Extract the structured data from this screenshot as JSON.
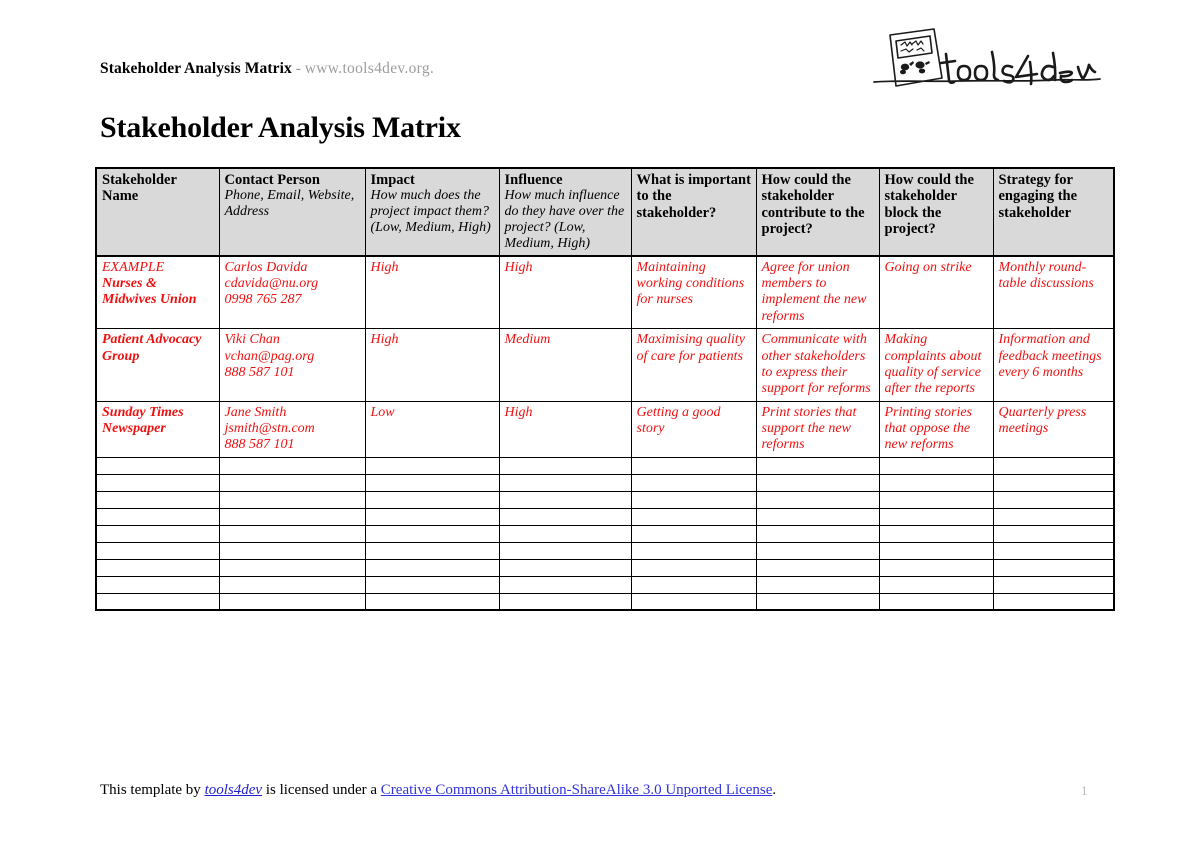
{
  "header": {
    "running_title": "Stakeholder Analysis Matrix",
    "separator": "-",
    "running_url": "www.tools4dev.org.",
    "logo_text": "tools4dev"
  },
  "document": {
    "title": "Stakeholder Analysis Matrix"
  },
  "table": {
    "columns": [
      {
        "main": "Stakeholder Name",
        "sub": ""
      },
      {
        "main": "Contact Person",
        "sub": "Phone, Email, Website, Address"
      },
      {
        "main": "Impact",
        "sub": "How much does the project impact them? (Low, Medium, High)"
      },
      {
        "main": "Influence",
        "sub": "How much influence do they have over the project? (Low, Medium, High)"
      },
      {
        "main": "What is important to the stakeholder?",
        "sub": ""
      },
      {
        "main": "How could the stakeholder contribute to the project?",
        "sub": ""
      },
      {
        "main": "How could the stakeholder block the project?",
        "sub": ""
      },
      {
        "main": "Strategy for engaging the stakeholder",
        "sub": ""
      }
    ],
    "rows": [
      {
        "name_prefix": "EXAMPLE",
        "name": "Nurses & Midwives Union",
        "contact_name": "Carlos Davida",
        "contact_email": "cdavida@nu.org",
        "contact_phone": "0998 765 287",
        "impact": "High",
        "influence": "High",
        "important": "Maintaining working conditions for nurses",
        "contribute": "Agree for union members to implement the new reforms",
        "block": "Going on strike",
        "strategy": "Monthly round-table discussions"
      },
      {
        "name_prefix": "",
        "name": "Patient Advocacy Group",
        "contact_name": "Viki Chan",
        "contact_email": "vchan@pag.org",
        "contact_phone": "888 587 101",
        "impact": "High",
        "influence": "Medium",
        "important": "Maximising quality of care for patients",
        "contribute": "Communicate with other stakeholders to express their support for reforms",
        "block": "Making complaints about quality of service after the reports",
        "strategy": "Information and feedback meetings every 6 months"
      },
      {
        "name_prefix": "",
        "name": "Sunday Times Newspaper",
        "contact_name": "Jane Smith",
        "contact_email": "jsmith@stn.com",
        "contact_phone": "888 587 101",
        "impact": "Low",
        "influence": "High",
        "important": "Getting a good story",
        "contribute": "Print stories that support the new reforms",
        "block": "Printing stories that oppose the new reforms",
        "strategy": "Quarterly press meetings"
      }
    ],
    "blank_row_count": 9
  },
  "footer": {
    "text_before": "This template by ",
    "tools4dev_link": "tools4dev",
    "text_middle": " is licensed under a ",
    "cc_link": "Creative Commons Attribution-ShareAlike 3.0 Unported License",
    "text_after": ".",
    "page_number": "1"
  },
  "colors": {
    "data_text": "#ee1111",
    "header_fill": "#d9d9d9",
    "muted_text": "#9d9d9d",
    "link": "#3333dd"
  }
}
